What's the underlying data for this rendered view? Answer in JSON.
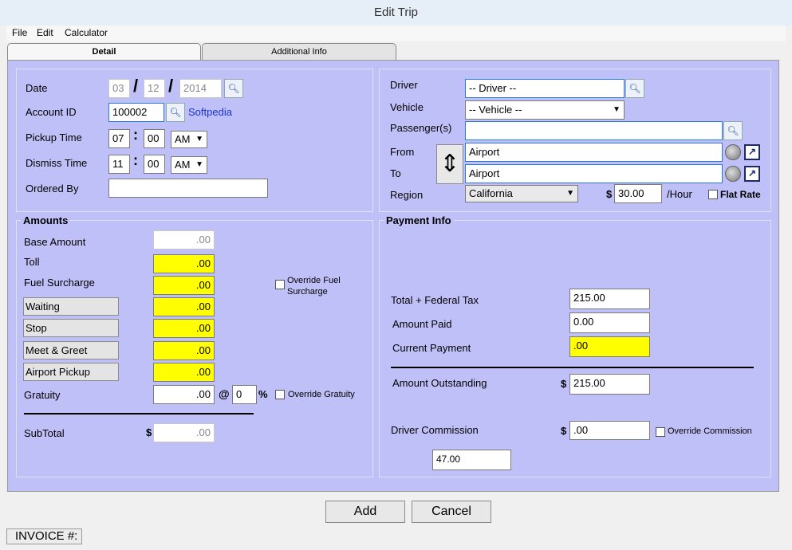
{
  "window": {
    "title": "Edit Trip"
  },
  "menu": {
    "file": "File",
    "edit": "Edit",
    "calculator": "Calculator"
  },
  "tabs": {
    "detail": "Detail",
    "additional": "Additional Info"
  },
  "trip": {
    "date_label": "Date",
    "date_month": "03",
    "date_day": "12",
    "date_year": "2014",
    "date_sep": "/",
    "account_label": "Account ID",
    "account_value": "100002",
    "account_name": "Softpedia",
    "pickup_label": "Pickup Time",
    "pickup_hour": "07",
    "pickup_min": "00",
    "pickup_ampm": "AM",
    "dismiss_label": "Dismiss Time",
    "dismiss_hour": "11",
    "dismiss_min": "00",
    "dismiss_ampm": "AM",
    "time_sep": ":",
    "ordered_label": "Ordered By",
    "ordered_value": ""
  },
  "driver": {
    "driver_label": "Driver",
    "driver_value": "-- Driver --",
    "vehicle_label": "Vehicle",
    "vehicle_value": "-- Vehicle --",
    "passengers_label": "Passenger(s)",
    "passengers_value": "",
    "from_label": "From",
    "from_value": "Airport",
    "to_label": "To",
    "to_value": "Airport",
    "region_label": "Region",
    "region_value": "California",
    "rate_currency": "$",
    "rate_value": "30.00",
    "rate_unit": "/Hour",
    "flat_rate_label": "Flat Rate"
  },
  "amounts": {
    "title": "Amounts",
    "base_label": "Base Amount",
    "base_value": ".00",
    "toll_label": "Toll",
    "toll_value": ".00",
    "fuel_label": "Fuel Surcharge",
    "fuel_value": ".00",
    "override_fuel_label": "Override Fuel Surcharge",
    "waiting_label": "Waiting",
    "waiting_value": ".00",
    "stop_label": "Stop",
    "stop_value": ".00",
    "meet_label": "Meet & Greet",
    "meet_value": ".00",
    "airport_label": "Airport Pickup",
    "airport_value": ".00",
    "gratuity_label": "Gratuity",
    "gratuity_value": ".00",
    "gratuity_at": "@",
    "gratuity_pct": "0",
    "pct_symbol": "%",
    "override_gratuity_label": "Override Gratuity",
    "subtotal_label": "SubTotal",
    "subtotal_currency": "$",
    "subtotal_value": ".00"
  },
  "payment": {
    "title": "Payment Info",
    "total_label": "Total + Federal Tax",
    "total_value": "215.00",
    "paid_label": "Amount Paid",
    "paid_value": "0.00",
    "current_label": "Current Payment",
    "current_value": ".00",
    "outstanding_label": "Amount Outstanding",
    "outstanding_currency": "$",
    "outstanding_value": "215.00",
    "commission_label": "Driver Commission",
    "commission_currency": "$",
    "commission_value": ".00",
    "override_commission_label": "Override Commission",
    "commission_extra": "47.00"
  },
  "buttons": {
    "add": "Add",
    "cancel": "Cancel"
  },
  "footer": {
    "invoice_label": "INVOICE #:"
  },
  "colors": {
    "panel": "#c0c0f8",
    "highlight": "#ffff00"
  }
}
